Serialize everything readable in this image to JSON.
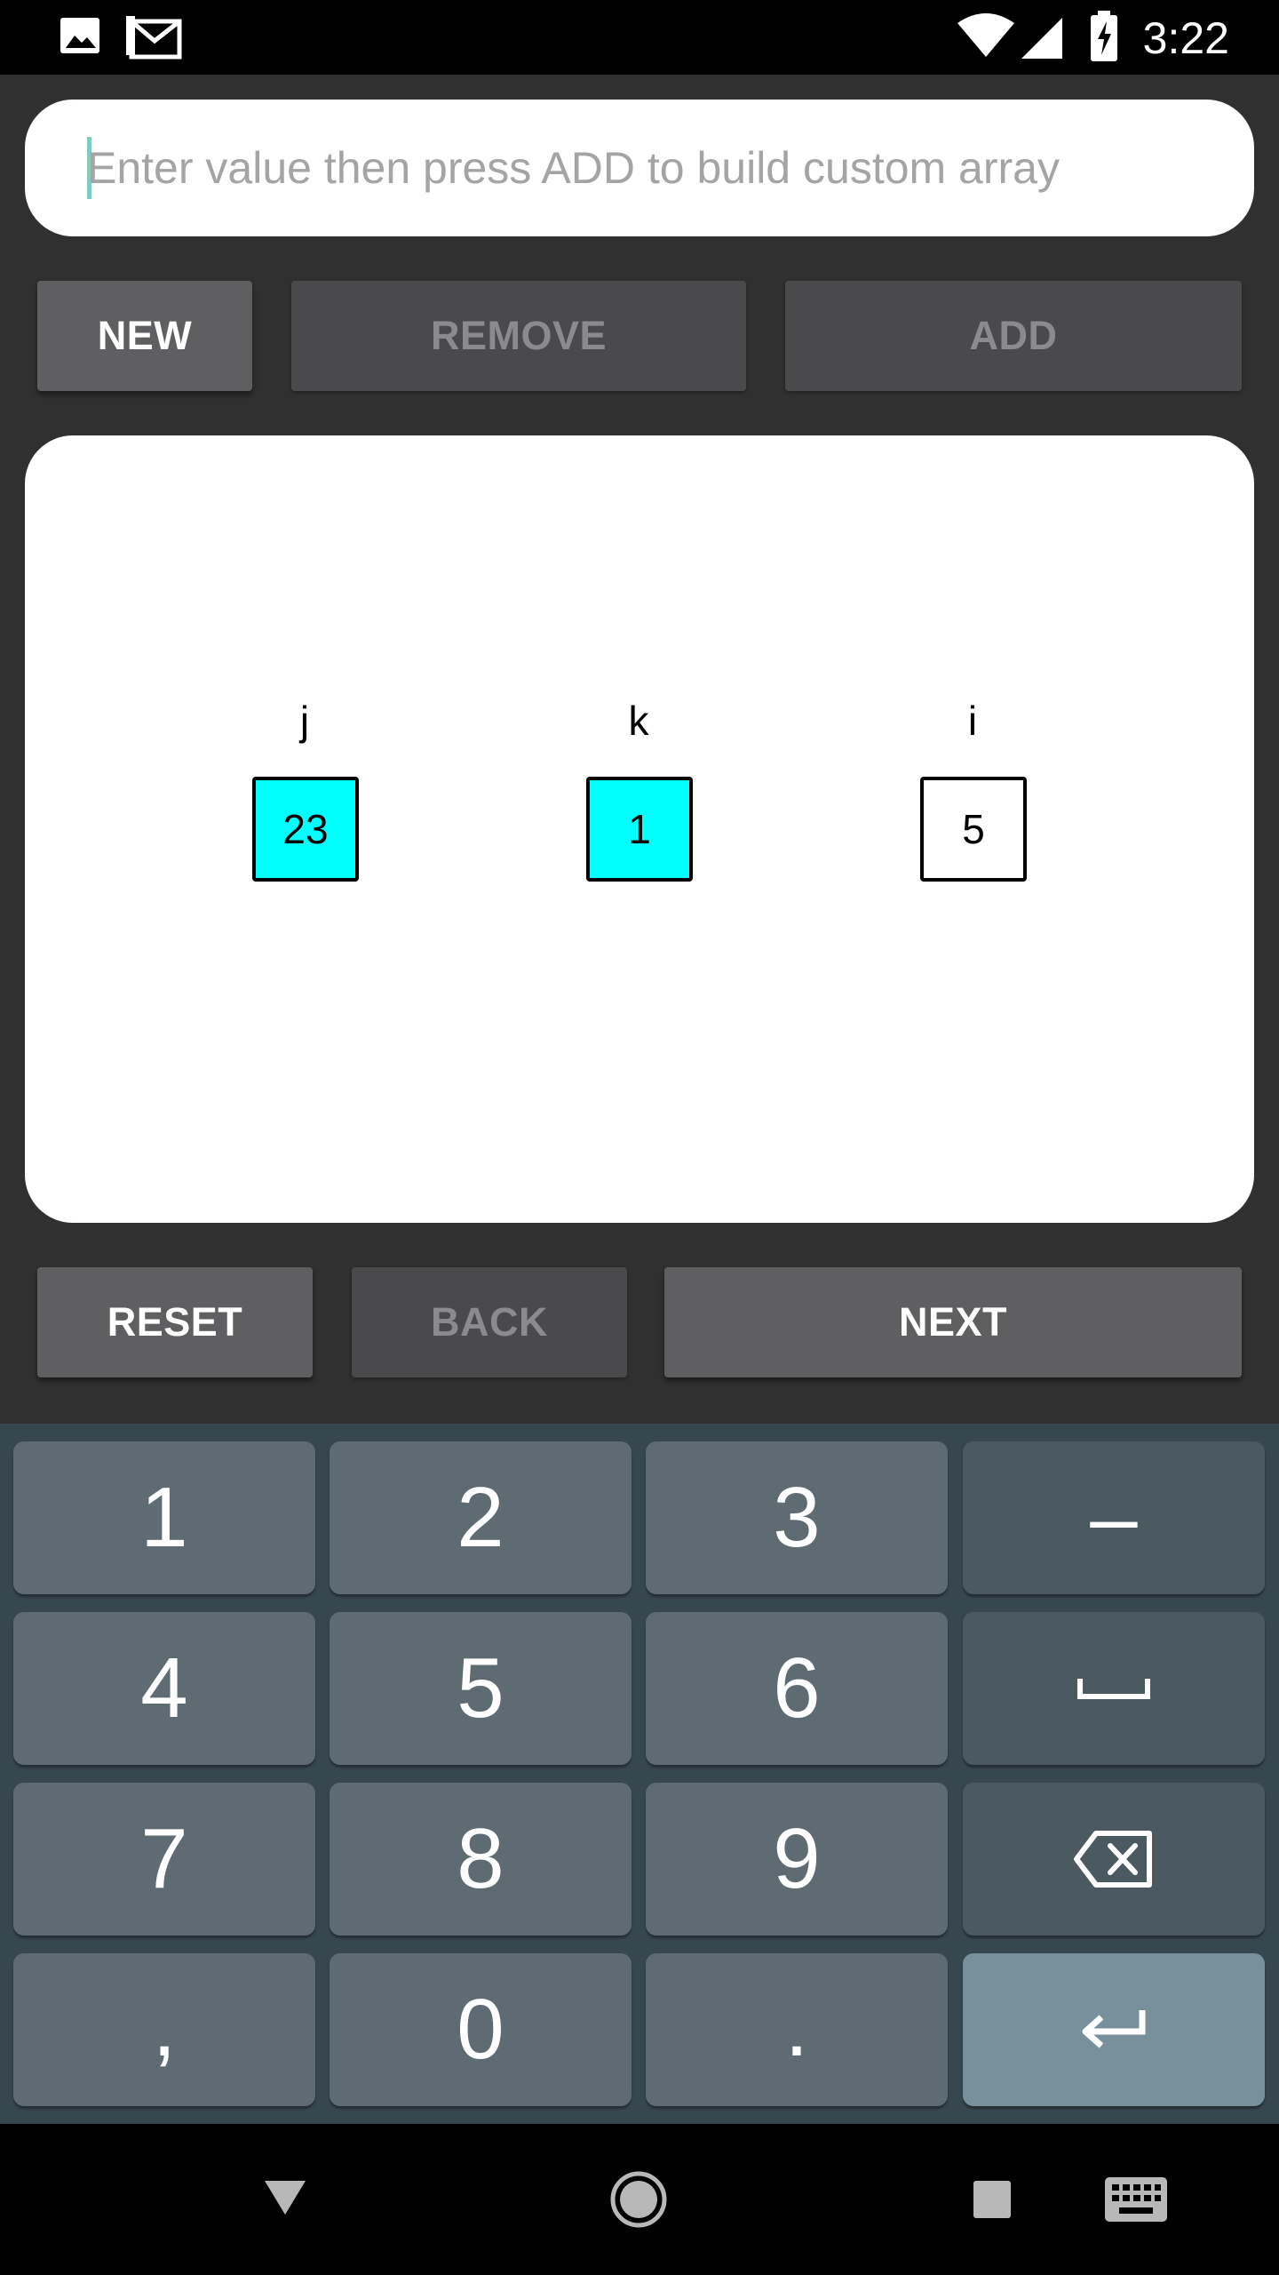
{
  "status_bar": {
    "time": "3:22",
    "left_icons": [
      "image-icon",
      "gmail-icon"
    ],
    "right_icons": [
      "wifi-icon",
      "cell-signal-icon",
      "battery-charging-icon"
    ]
  },
  "input": {
    "placeholder": "Enter value then press ADD to build custom array",
    "value": ""
  },
  "top_buttons": {
    "new": "NEW",
    "remove": "REMOVE",
    "add": "ADD"
  },
  "array_view": {
    "cells": [
      {
        "pointer": "j",
        "value": "23",
        "highlighted": true
      },
      {
        "pointer": "k",
        "value": "1",
        "highlighted": true
      },
      {
        "pointer": "i",
        "value": "5",
        "highlighted": false
      }
    ],
    "highlight_color": "#00ffff"
  },
  "bottom_buttons": {
    "reset": "RESET",
    "back": "BACK",
    "next": "NEXT"
  },
  "keyboard": {
    "rows": [
      [
        "1",
        "2",
        "3",
        "–"
      ],
      [
        "4",
        "5",
        "6",
        "space"
      ],
      [
        "7",
        "8",
        "9",
        "backspace"
      ],
      [
        ",",
        "0",
        ".",
        "enter"
      ]
    ],
    "labels": {
      "k1": "1",
      "k2": "2",
      "k3": "3",
      "minus": "–",
      "k4": "4",
      "k5": "5",
      "k6": "6",
      "k7": "7",
      "k8": "8",
      "k9": "9",
      "comma": ",",
      "k0": "0",
      "period": "."
    }
  },
  "nav_bar": {
    "icons": [
      "back-icon",
      "home-icon",
      "recents-icon",
      "keyboard-icon"
    ]
  },
  "colors": {
    "background": "#303030",
    "button": "#5f5f61",
    "button_disabled": "#4a4a4c",
    "keyboard_bg": "#37474f",
    "key": "#5e6b72",
    "enter_key": "#78909c"
  }
}
